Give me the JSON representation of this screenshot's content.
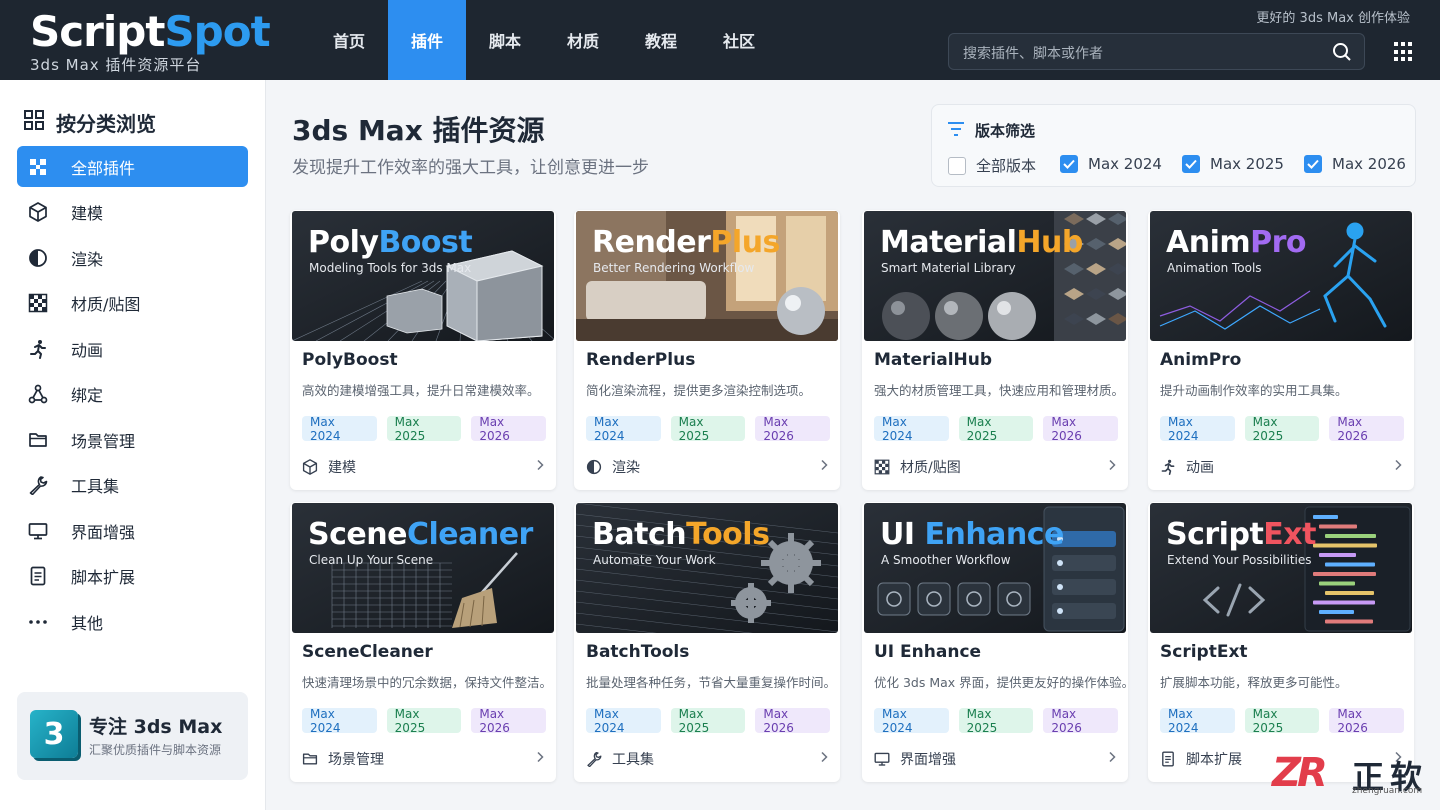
{
  "brand": {
    "name_a": "Script",
    "name_b": "Spot",
    "subtitle": "3ds Max 插件资源平台",
    "tagline": "更好的 3ds Max 创作体验"
  },
  "nav": [
    {
      "label": "首页",
      "active": false
    },
    {
      "label": "插件",
      "active": true
    },
    {
      "label": "脚本",
      "active": false
    },
    {
      "label": "材质",
      "active": false
    },
    {
      "label": "教程",
      "active": false
    },
    {
      "label": "社区",
      "active": false
    }
  ],
  "search": {
    "placeholder": "搜索插件、脚本或作者"
  },
  "sidebar": {
    "title": "按分类浏览",
    "items": [
      {
        "label": "全部插件",
        "icon": "all-plugins-icon",
        "active": true
      },
      {
        "label": "建模",
        "icon": "cube-icon"
      },
      {
        "label": "渲染",
        "icon": "half-circle-icon"
      },
      {
        "label": "材质/贴图",
        "icon": "checker-icon"
      },
      {
        "label": "动画",
        "icon": "running-figure-icon"
      },
      {
        "label": "绑定",
        "icon": "node-graph-icon"
      },
      {
        "label": "场景管理",
        "icon": "folder-icon"
      },
      {
        "label": "工具集",
        "icon": "wrench-icon"
      },
      {
        "label": "界面增强",
        "icon": "monitor-icon"
      },
      {
        "label": "脚本扩展",
        "icon": "document-icon"
      },
      {
        "label": "其他",
        "icon": "more-dots-icon"
      }
    ],
    "promo": {
      "logo": "3",
      "title": "专注 3ds Max",
      "subtitle": "汇聚优质插件与脚本资源"
    }
  },
  "main": {
    "title": "3ds Max 插件资源",
    "subtitle": "发现提升工作效率的强大工具，让创意更进一步"
  },
  "filter": {
    "title": "版本筛选",
    "options": [
      {
        "label": "全部版本",
        "checked": false
      },
      {
        "label": "Max 2024",
        "checked": true
      },
      {
        "label": "Max 2025",
        "checked": true
      },
      {
        "label": "Max 2026",
        "checked": true
      }
    ]
  },
  "cards": [
    {
      "thumb_a": "Poly",
      "thumb_b": "Boost",
      "thumb_sub": "Modeling Tools for 3ds Max",
      "accent": "#3fa3f5",
      "name": "PolyBoost",
      "desc": "高效的建模增强工具，提升日常建模效率。",
      "tags": [
        "Max 2024",
        "Max 2025",
        "Max 2026"
      ],
      "category": "建模",
      "cat_icon": "cube-icon"
    },
    {
      "thumb_a": "Render",
      "thumb_b": "Plus",
      "thumb_sub": "Better Rendering Workflow",
      "accent": "#f4a62a",
      "name": "RenderPlus",
      "desc": "简化渲染流程，提供更多渲染控制选项。",
      "tags": [
        "Max 2024",
        "Max 2025",
        "Max 2026"
      ],
      "category": "渲染",
      "cat_icon": "half-circle-icon"
    },
    {
      "thumb_a": "Material",
      "thumb_b": "Hub",
      "thumb_sub": "Smart Material Library",
      "accent": "#f4a62a",
      "name": "MaterialHub",
      "desc": "强大的材质管理工具，快速应用和管理材质。",
      "tags": [
        "Max 2024",
        "Max 2025",
        "Max 2026"
      ],
      "category": "材质/贴图",
      "cat_icon": "checker-icon"
    },
    {
      "thumb_a": "Anim",
      "thumb_b": "Pro",
      "thumb_sub": "Animation Tools",
      "accent": "#a26bf2",
      "name": "AnimPro",
      "desc": "提升动画制作效率的实用工具集。",
      "tags": [
        "Max 2024",
        "Max 2025",
        "Max 2026"
      ],
      "category": "动画",
      "cat_icon": "running-figure-icon"
    },
    {
      "thumb_a": "Scene",
      "thumb_b": "Cleaner",
      "thumb_sub": "Clean Up Your Scene",
      "accent": "#3fa3f5",
      "name": "SceneCleaner",
      "desc": "快速清理场景中的冗余数据，保持文件整洁。",
      "tags": [
        "Max 2024",
        "Max 2025",
        "Max 2026"
      ],
      "category": "场景管理",
      "cat_icon": "folder-icon"
    },
    {
      "thumb_a": "Batch",
      "thumb_b": "Tools",
      "thumb_sub": "Automate Your Work",
      "accent": "#f4a62a",
      "name": "BatchTools",
      "desc": "批量处理各种任务，节省大量重复操作时间。",
      "tags": [
        "Max 2024",
        "Max 2025",
        "Max 2026"
      ],
      "category": "工具集",
      "cat_icon": "wrench-icon"
    },
    {
      "thumb_a": "UI ",
      "thumb_b": "Enhance",
      "thumb_sub": "A Smoother Workflow",
      "accent": "#3fa3f5",
      "name": "UI Enhance",
      "desc": "优化 3ds Max 界面，提供更友好的操作体验。",
      "tags": [
        "Max 2024",
        "Max 2025",
        "Max 2026"
      ],
      "category": "界面增强",
      "cat_icon": "monitor-icon"
    },
    {
      "thumb_a": "Script",
      "thumb_b": "Ext",
      "thumb_sub": "Extend Your Possibilities",
      "accent": "#f0545f",
      "name": "ScriptExt",
      "desc": "扩展脚本功能，释放更多可能性。",
      "tags": [
        "Max 2024",
        "Max 2025",
        "Max 2026"
      ],
      "category": "脚本扩展",
      "cat_icon": "document-icon"
    }
  ],
  "watermark": {
    "mark": "ZR",
    "text": "正软",
    "url": "zhengruan.com"
  }
}
